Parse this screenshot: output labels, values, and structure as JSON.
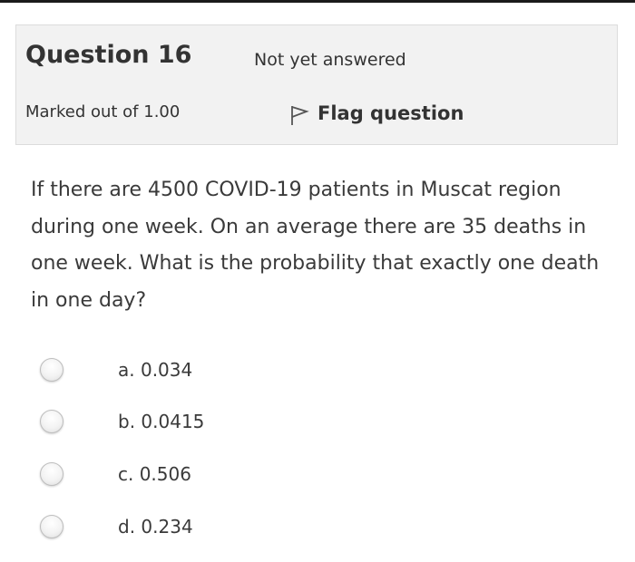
{
  "question": {
    "number_label": "Question 16",
    "state": "Not yet answered",
    "grade": "Marked out of 1.00",
    "flag_label": "Flag question",
    "text": "If there are 4500 COVID-19 patients in Muscat region during one week. On an average there are 35 deaths in one week. What is the probability that exactly one death in one day?"
  },
  "options": [
    {
      "label": "a. 0.034",
      "selected": false
    },
    {
      "label": "b. 0.0415",
      "selected": false
    },
    {
      "label": "c. 0.506",
      "selected": false
    },
    {
      "label": "d. 0.234",
      "selected": false
    }
  ],
  "icons": {
    "flag": "flag-outline-icon",
    "radio": "radio-unchecked-icon"
  }
}
